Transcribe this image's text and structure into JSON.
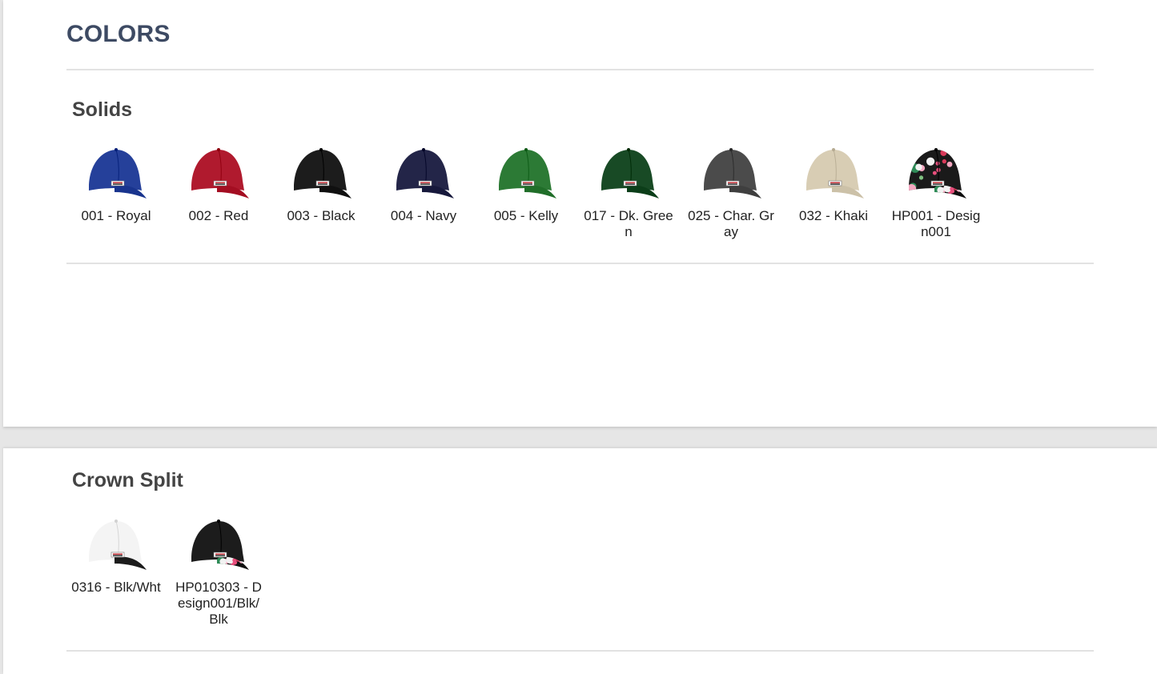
{
  "page": {
    "title": "COLORS"
  },
  "sections": [
    {
      "title": "Solids",
      "swatches": [
        {
          "label": "001 - Royal",
          "color": "#25409a",
          "pattern": "solid"
        },
        {
          "label": "002 - Red",
          "color": "#b01a2e",
          "pattern": "solid"
        },
        {
          "label": "003 - Black",
          "color": "#1c1c1c",
          "pattern": "solid"
        },
        {
          "label": "004 - Navy",
          "color": "#232548",
          "pattern": "solid"
        },
        {
          "label": "005 - Kelly",
          "color": "#2c7a35",
          "pattern": "solid"
        },
        {
          "label": "017 - Dk. Green",
          "color": "#184a25",
          "pattern": "solid"
        },
        {
          "label": "025 - Char. Gray",
          "color": "#4b4b4b",
          "pattern": "solid"
        },
        {
          "label": "032 - Khaki",
          "color": "#d8cdb4",
          "pattern": "solid"
        },
        {
          "label": "HP001 - Design001",
          "color": "#1a1a1a",
          "pattern": "floral"
        }
      ]
    },
    {
      "title": "Crown Split",
      "swatches": [
        {
          "label": "0316 - Blk/Wht",
          "color": "#f4f4f4",
          "visor_color": "#1c1c1c",
          "pattern": "split"
        },
        {
          "label": "HP010303 - Design001/Blk/Blk",
          "color": "#1c1c1c",
          "pattern": "floral-visor"
        }
      ]
    }
  ]
}
